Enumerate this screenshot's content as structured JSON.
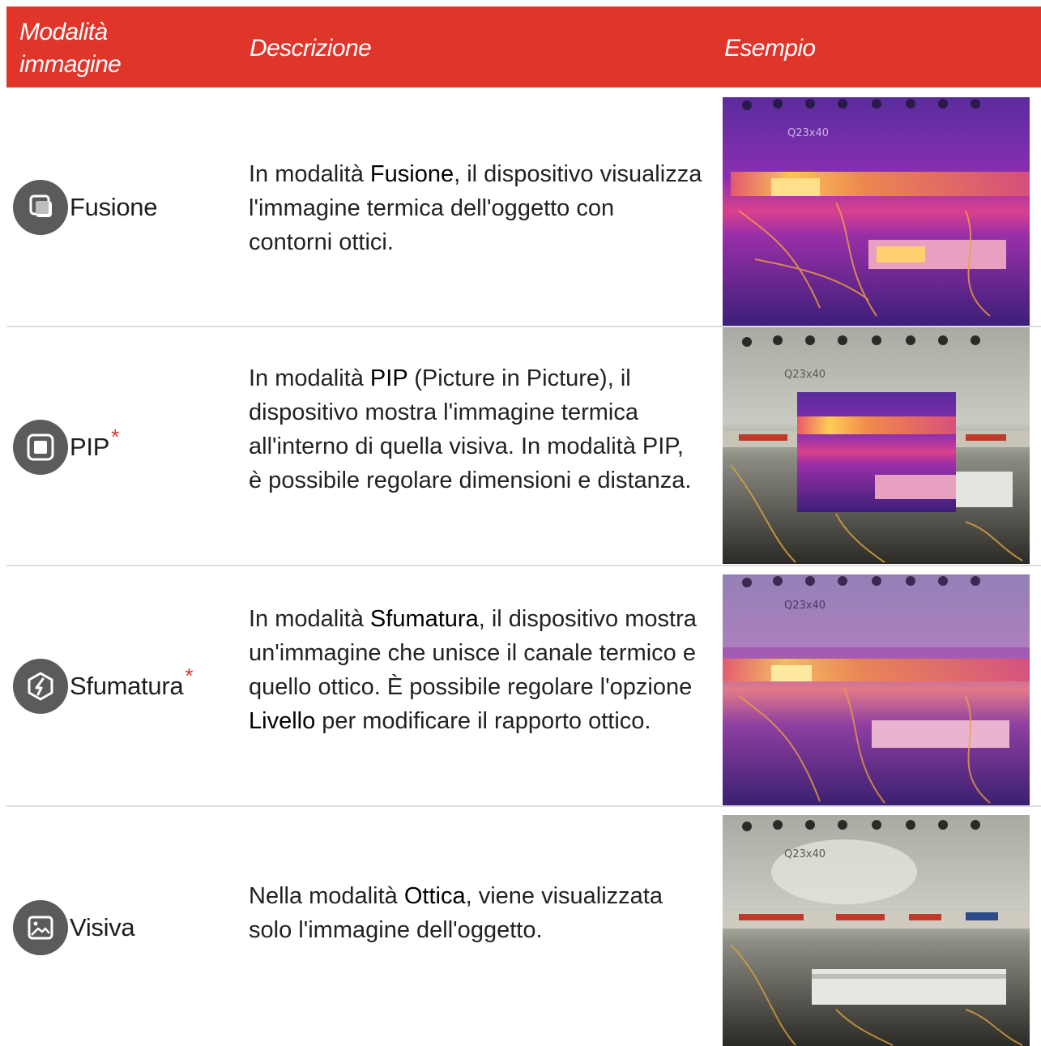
{
  "header": {
    "mode": "Modalità immagine",
    "description": "Descrizione",
    "example": "Esempio"
  },
  "colors": {
    "accent": "#e0352b",
    "icon_bg": "#5b5b5b",
    "divider": "#dedede"
  },
  "rows": [
    {
      "icon": "fusion-icon",
      "label": "Fusione",
      "asterisk": "",
      "desc": {
        "t1": "In modalità ",
        "b1": "Fusione",
        "t2": ", il dispositivo visualizza l'immagine termica dell'oggetto con contorni ottici."
      }
    },
    {
      "icon": "pip-icon",
      "label": "PIP",
      "asterisk": "*",
      "desc": {
        "t1": "In modalità ",
        "b1": "PIP",
        "t2": " (Picture in Picture), il dispositivo mostra l'immagine termica all'interno di quella visiva. In modalità PIP, è possibile regolare dimensioni e distanza."
      }
    },
    {
      "icon": "blend-icon",
      "label": "Sfumatura",
      "asterisk": "*",
      "desc": {
        "t1": "In modalità ",
        "b1": "Sfumatura",
        "t2": ", il dispositivo mostra un'immagine che unisce il canale termico e quello ottico. È possibile regolare l'opzione ",
        "b2": "Livello",
        "t3": " per modificare il rapporto ottico."
      }
    },
    {
      "icon": "image-icon",
      "label": "Visiva",
      "asterisk": "",
      "desc": {
        "t1": "Nella modalità ",
        "b1": "Ottica",
        "t2": ", viene visualizzata solo l'immagine dell'oggetto."
      }
    }
  ],
  "thumb_text": "Q23x40"
}
